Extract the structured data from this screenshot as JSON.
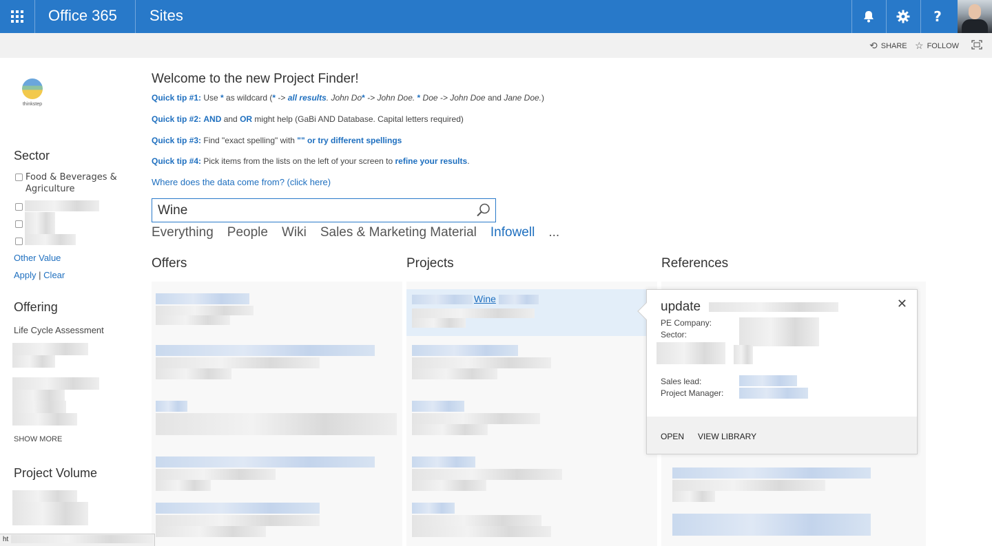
{
  "topbar": {
    "waffle_icon": "app-launcher-icon",
    "brand": "Office 365",
    "section": "Sites",
    "notifications_icon": "bell-icon",
    "settings_icon": "gear-icon",
    "help_icon": "?",
    "avatar": "user-avatar"
  },
  "subbar": {
    "share_label": "SHARE",
    "follow_label": "FOLLOW",
    "focus_icon": "focus-mode-icon"
  },
  "logo": {
    "text": "thinkstep"
  },
  "sector": {
    "heading": "Sector",
    "items": [
      {
        "label": "Food & Beverages & Agriculture"
      }
    ],
    "other_value": "Other Value",
    "apply": "Apply",
    "separator": "|",
    "clear": "Clear"
  },
  "offering": {
    "heading": "Offering",
    "first_item": "Life Cycle Assessment",
    "show_more": "SHOW MORE"
  },
  "project_volume": {
    "heading": "Project Volume"
  },
  "welcome": {
    "title": "Welcome to the new Project Finder!",
    "tip1": {
      "label": "Quick tip #1:",
      "t1": " Use ",
      "star1": "*",
      "t2": " as wildcard (",
      "star2": "*",
      "arrow1": " -> ",
      "all": "all results",
      "t3": ". John Do",
      "star3": "*",
      "t4": " -> John Doe. ",
      "star4": "*",
      "t5": " Doe -> John Doe",
      "t6": " and ",
      "t7": "Jane Doe.",
      "t8": ")"
    },
    "tip2": {
      "label": "Quick tip #2:",
      "and": "AND",
      "t1": " and ",
      "or": "OR",
      "t2": " might help (GaBi AND Database. Capital letters required)"
    },
    "tip3": {
      "label": "Quick tip #3:",
      "t1": "  Find \"exact spelling\" with ",
      "quotes": "\"\" or try different spellings"
    },
    "tip4": {
      "label": "Quick tip #4:",
      "t1": " Pick items from the lists on the left of your screen to ",
      "refine": "refine your results",
      "t2": "."
    },
    "data_link": "Where does the data come from? (click here)"
  },
  "search": {
    "value": "Wine",
    "icon": "search-icon"
  },
  "verticals": [
    {
      "label": "Everything"
    },
    {
      "label": "People"
    },
    {
      "label": "Wiki"
    },
    {
      "label": "Sales & Marketing Material"
    },
    {
      "label": "Infowell",
      "selected": true
    },
    {
      "label": "..."
    }
  ],
  "columns": {
    "offers": "Offers",
    "projects": "Projects",
    "references": "References"
  },
  "project_hit": {
    "title_link": "Wine"
  },
  "callout": {
    "title": "update",
    "close": "✕",
    "pe_company": "PE Company:",
    "sector": "Sector:",
    "sales_lead": "Sales lead:",
    "project_manager": "Project Manager:",
    "open": "OPEN",
    "view_library": "VIEW LIBRARY"
  },
  "status": {
    "url_prefix": "ht"
  },
  "colors": {
    "suite_bar": "#2879c9",
    "link": "#1e6fbf"
  }
}
